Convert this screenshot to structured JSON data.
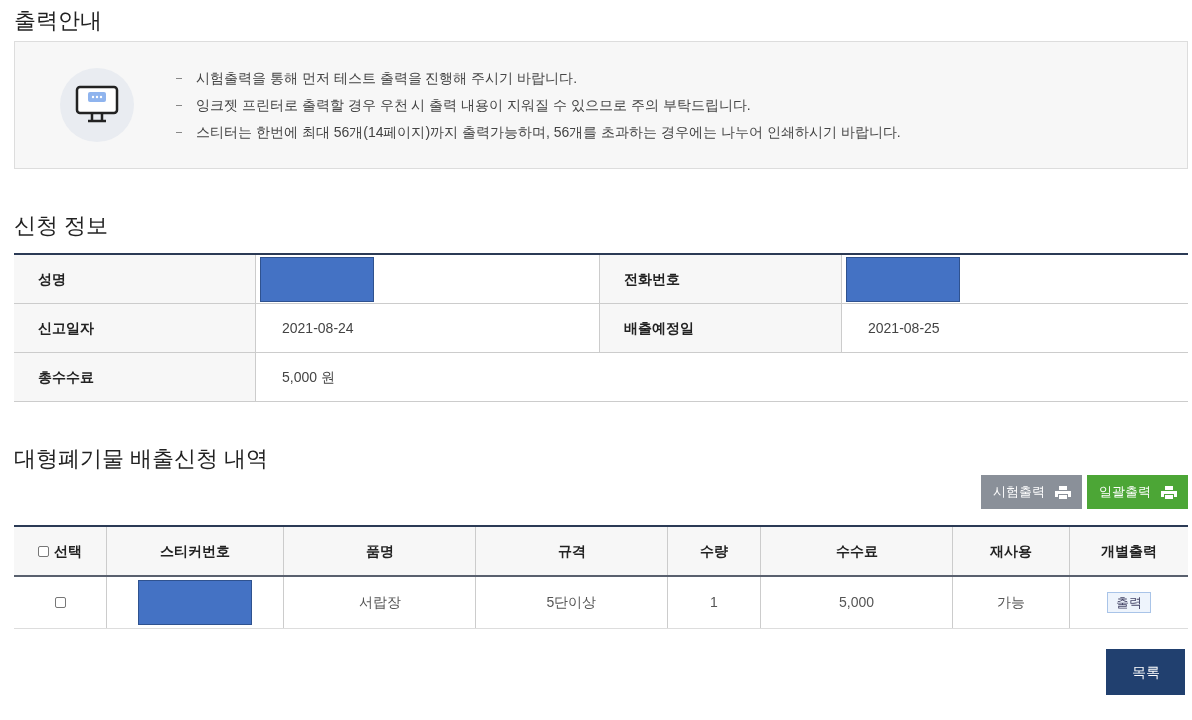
{
  "notice": {
    "title": "출력안내",
    "lines": [
      "시험출력을 통해 먼저 테스트 출력을 진행해 주시기 바랍니다.",
      "잉크젯 프린터로 출력할 경우 우천 시 출력 내용이 지워질 수 있으므로 주의 부탁드립니다.",
      "스티터는 한번에 최대 56개(14페이지)까지 출력가능하며, 56개를 초과하는 경우에는 나누어 인쇄하시기 바랍니다."
    ]
  },
  "applicant": {
    "title": "신청 정보",
    "rows": [
      [
        {
          "label": "성명",
          "kind": "redacted"
        },
        {
          "label": "전화번호",
          "kind": "redacted"
        }
      ],
      [
        {
          "label": "신고일자",
          "kind": "text",
          "value": "2021-08-24"
        },
        {
          "label": "배출예정일",
          "kind": "text",
          "value": "2021-08-25"
        }
      ],
      [
        {
          "label": "총수수료",
          "kind": "text",
          "value": "5,000 원"
        }
      ]
    ]
  },
  "items": {
    "title": "대형폐기물 배출신청 내역",
    "buttons": [
      {
        "label": "시험출력",
        "kind": "gray"
      },
      {
        "label": "일괄출력",
        "kind": "green"
      }
    ],
    "columns": [
      {
        "label": "선택",
        "kind": "checkbox",
        "checked": false
      },
      {
        "label": "스티커번호",
        "kind": "text"
      },
      {
        "label": "품명",
        "kind": "text"
      },
      {
        "label": "규격",
        "kind": "text"
      },
      {
        "label": "수량",
        "kind": "text"
      },
      {
        "label": "수수료",
        "kind": "text"
      },
      {
        "label": "재사용",
        "kind": "text"
      },
      {
        "label": "개별출력",
        "kind": "text"
      }
    ],
    "rows": [
      {
        "cells": [
          {
            "kind": "checkbox",
            "checked": false
          },
          {
            "kind": "redacted"
          },
          {
            "kind": "text",
            "value": "서랍장"
          },
          {
            "kind": "text",
            "value": "5단이상"
          },
          {
            "kind": "text",
            "value": "1"
          },
          {
            "kind": "text",
            "value": "5,000"
          },
          {
            "kind": "text",
            "value": "가능"
          },
          {
            "kind": "button",
            "value": "출력"
          }
        ]
      }
    ]
  },
  "list_button": "목록"
}
